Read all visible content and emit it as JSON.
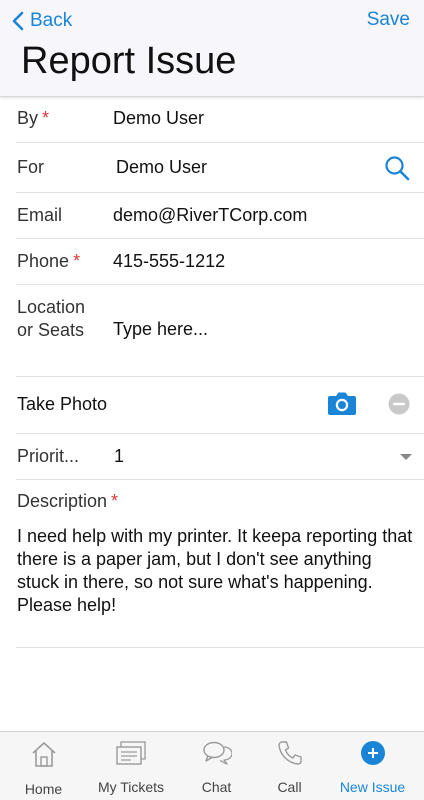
{
  "header": {
    "back_label": "Back",
    "save_label": "Save",
    "title": "Report Issue"
  },
  "form": {
    "by": {
      "label": "By",
      "required": "*",
      "value": "Demo User"
    },
    "for": {
      "label": "For",
      "value": "Demo User",
      "icon": "search-icon"
    },
    "email": {
      "label": "Email",
      "value": "demo@RiverTCorp.com"
    },
    "phone": {
      "label": "Phone",
      "required": "*",
      "value": "415-555-1212"
    },
    "location": {
      "label": "Location or Seats",
      "placeholder": "Type here..."
    },
    "photo": {
      "label": "Take Photo",
      "icons": [
        "camera-icon",
        "remove-icon"
      ]
    },
    "priority": {
      "label": "Priorit...",
      "value": "1"
    },
    "description": {
      "label": "Description",
      "required": "*",
      "value": "I need help with my printer.  It keepa reporting that there is a paper jam, but I don't see anything stuck in there, so not sure what's happening.  Please help!"
    }
  },
  "tabs": [
    {
      "label": "Home",
      "icon": "home-icon"
    },
    {
      "label": "My Tickets",
      "icon": "tickets-icon"
    },
    {
      "label": "Chat",
      "icon": "chat-icon"
    },
    {
      "label": "Call",
      "icon": "phone-icon"
    },
    {
      "label": "New Issue",
      "icon": "plus-circle-icon",
      "active": true
    }
  ],
  "colors": {
    "accent": "#1a85d6",
    "required": "#d93a3a",
    "header_bg": "#f6f6fb",
    "tabbar_bg": "#f6f6f6"
  }
}
